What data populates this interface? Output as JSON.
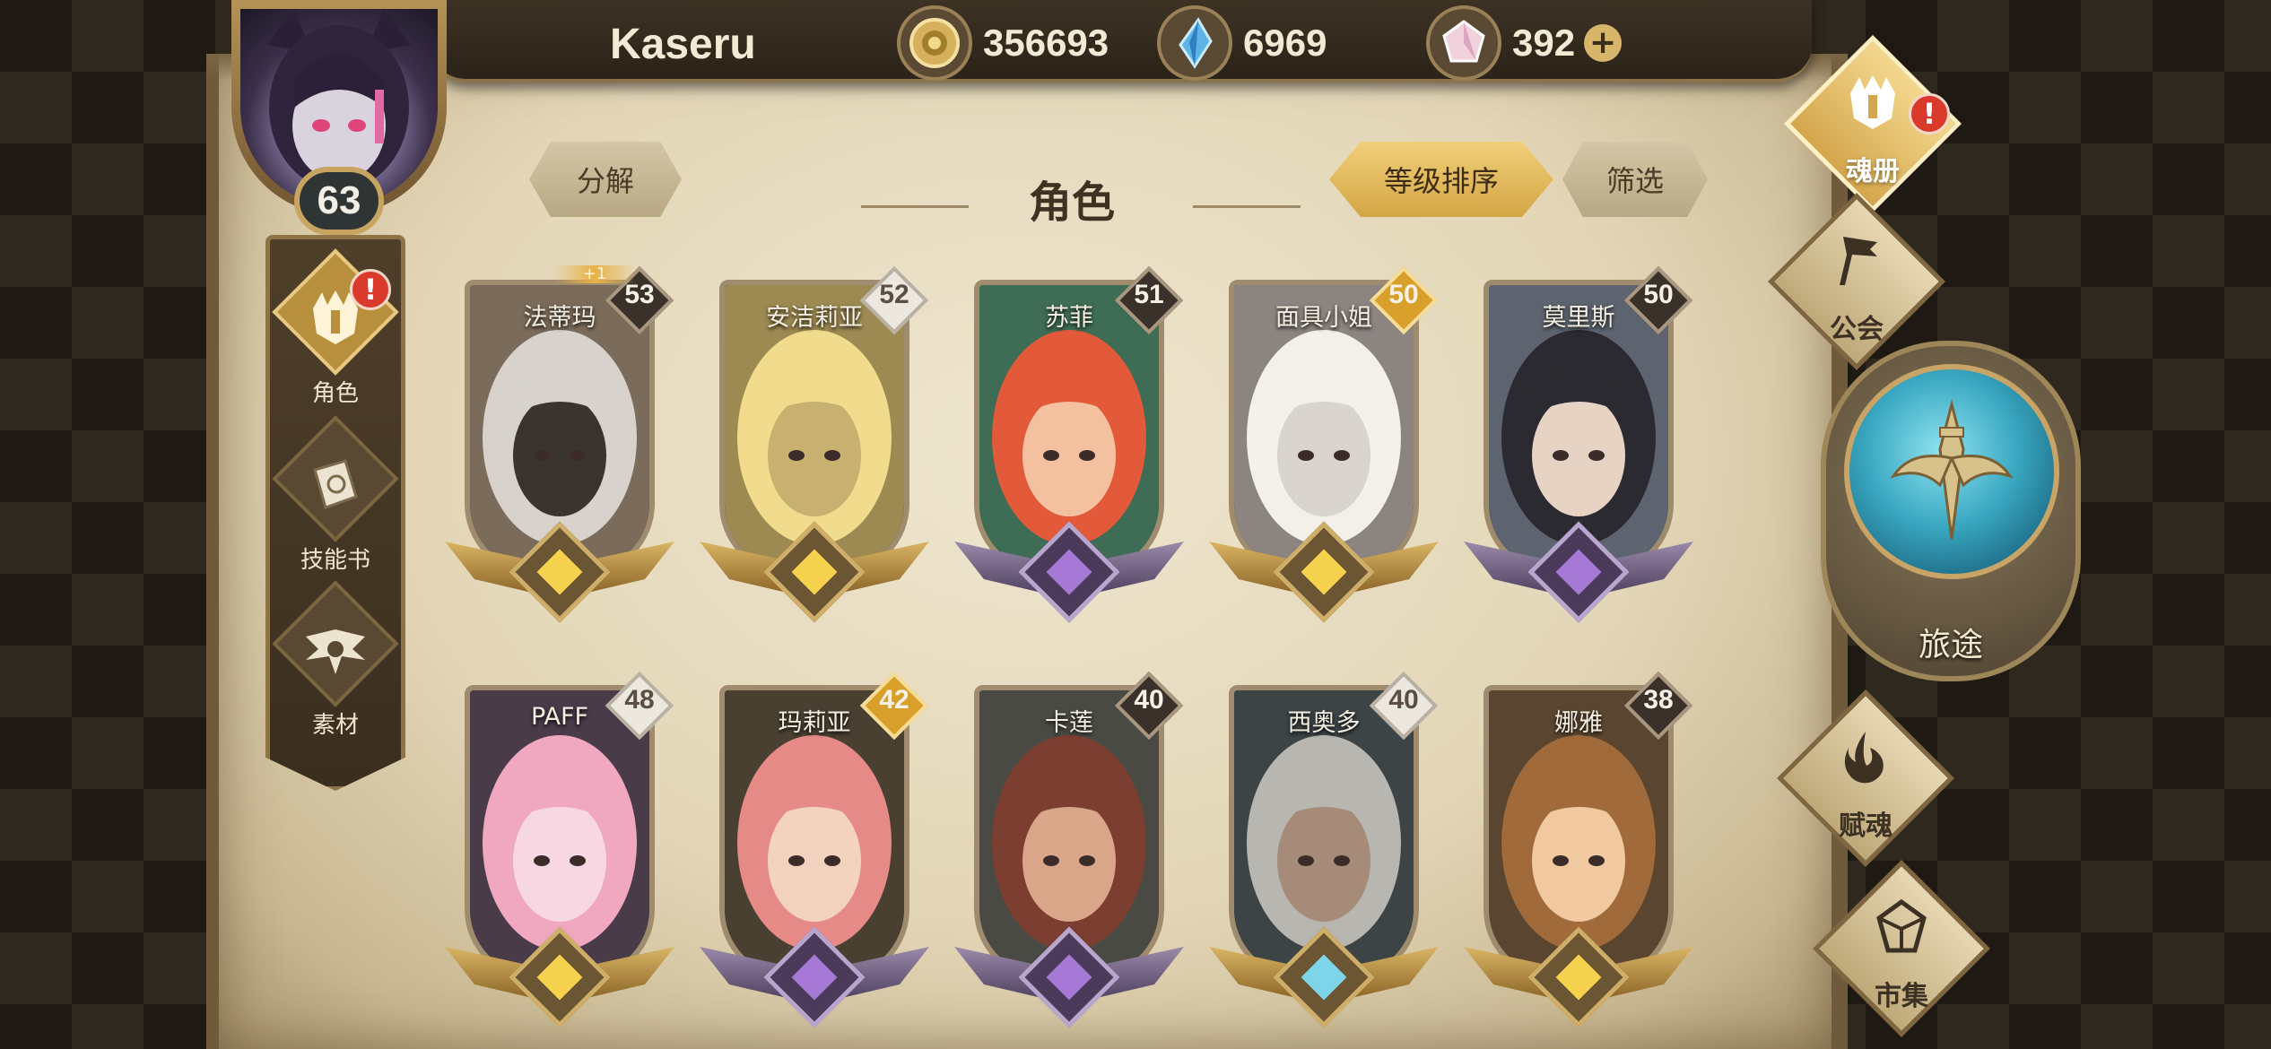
{
  "player": {
    "name": "Kaseru",
    "level": "63"
  },
  "currencies": [
    {
      "icon": "gold-coin-icon",
      "value": "356693"
    },
    {
      "icon": "blue-crystal-icon",
      "value": "6969"
    },
    {
      "icon": "pink-gem-icon",
      "value": "392",
      "plus": "+"
    }
  ],
  "header": {
    "title": "角色",
    "decompose_label": "分解",
    "sort_label": "等级排序",
    "filter_label": "筛选"
  },
  "left_menu": [
    {
      "label": "角色",
      "icon": "helmet-icon",
      "alert": "!"
    },
    {
      "label": "技能书",
      "icon": "skill-book-icon"
    },
    {
      "label": "素材",
      "icon": "material-icon"
    }
  ],
  "right_nav": {
    "soul_book": {
      "label": "魂册",
      "icon": "soul-book-icon",
      "alert": "!"
    },
    "guild": {
      "label": "公会",
      "icon": "guild-banner-icon"
    },
    "journey": {
      "label": "旅途",
      "icon": "journey-emblem-icon"
    },
    "soul_gift": {
      "label": "赋魂",
      "icon": "flame-icon"
    },
    "market": {
      "label": "市集",
      "icon": "market-crystal-icon"
    }
  },
  "characters": [
    {
      "name": "法蒂玛",
      "level": "53",
      "badge": "dark",
      "rarity": "gold",
      "plus": "+1"
    },
    {
      "name": "安洁莉亚",
      "level": "52",
      "badge": "white",
      "rarity": "gold"
    },
    {
      "name": "苏菲",
      "level": "51",
      "badge": "dark",
      "rarity": "purple"
    },
    {
      "name": "面具小姐",
      "level": "50",
      "badge": "gold",
      "rarity": "gold"
    },
    {
      "name": "莫里斯",
      "level": "50",
      "badge": "dark",
      "rarity": "purple"
    },
    {
      "name": "PAFF",
      "level": "48",
      "badge": "white",
      "rarity": "gold"
    },
    {
      "name": "玛莉亚",
      "level": "42",
      "badge": "gold",
      "rarity": "purple"
    },
    {
      "name": "卡莲",
      "level": "40",
      "badge": "dark",
      "rarity": "purple"
    },
    {
      "name": "西奥多",
      "level": "40",
      "badge": "white",
      "rarity": "blue"
    },
    {
      "name": "娜雅",
      "level": "38",
      "badge": "dark",
      "rarity": "gold"
    }
  ],
  "colors": {
    "parchment": "#e3d6b7",
    "gold_accent": "#d3a544",
    "dark_frame": "#3a2e1f",
    "alert_red": "#d93a2b",
    "journey_orb": "#3aa8c2"
  }
}
